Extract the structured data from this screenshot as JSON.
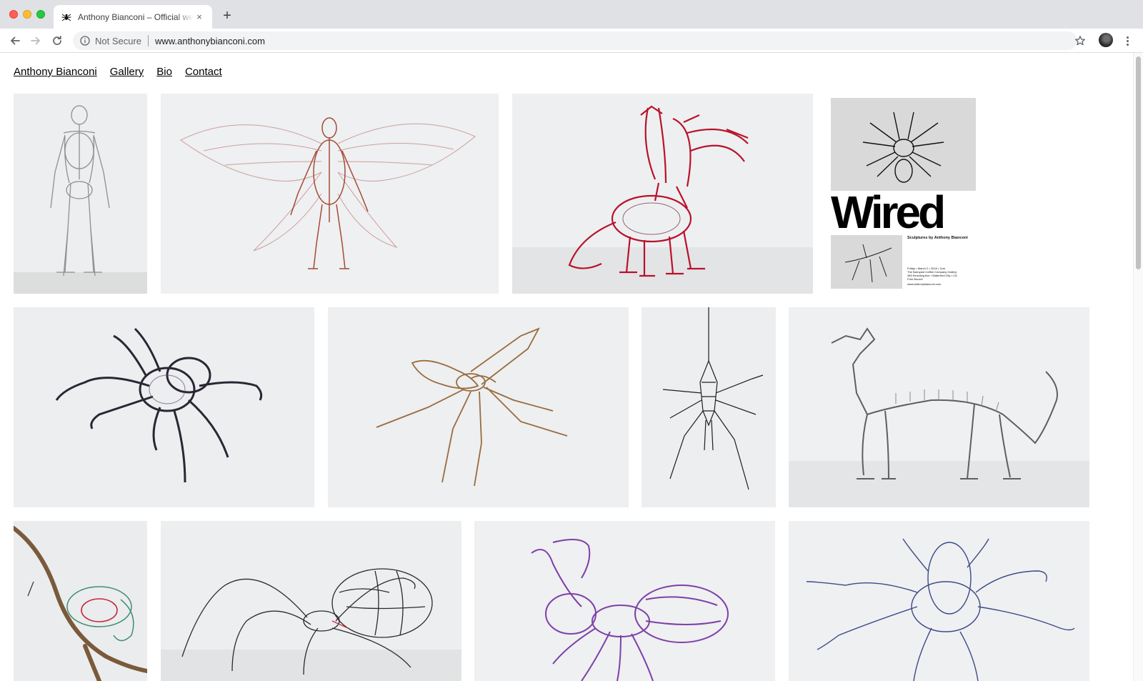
{
  "browser": {
    "tab_title": "Anthony Bianconi – Official website",
    "tab_close": "×",
    "new_tab": "+",
    "omnibox": {
      "security_label": "Not Secure",
      "url": "www.anthonybianconi.com"
    }
  },
  "site": {
    "nav": [
      {
        "label": "Anthony Bianconi"
      },
      {
        "label": "Gallery"
      },
      {
        "label": "Bio"
      },
      {
        "label": "Contact"
      }
    ]
  },
  "gallery": {
    "poster": {
      "title": "Wired",
      "subtitle": "Sculptures by Anthony Bianconi",
      "event_lines": [
        "Friday • March 2 • 2018 • 7pm",
        "The Barnyard Coffee Company Gallery",
        "365 Kinsolvig Ave • Waterford City • CA",
        "Free Booze!",
        "www.anthonybianconi.com"
      ]
    }
  },
  "colors": {
    "wire_silver": "#8f8f8f",
    "wire_copper": "#b25a3c",
    "wire_red": "#b8122a",
    "wire_black": "#2b2633",
    "wire_bronze": "#9a6b3d",
    "wire_purple": "#7f3fa8",
    "wire_blue": "#3d4a85"
  }
}
